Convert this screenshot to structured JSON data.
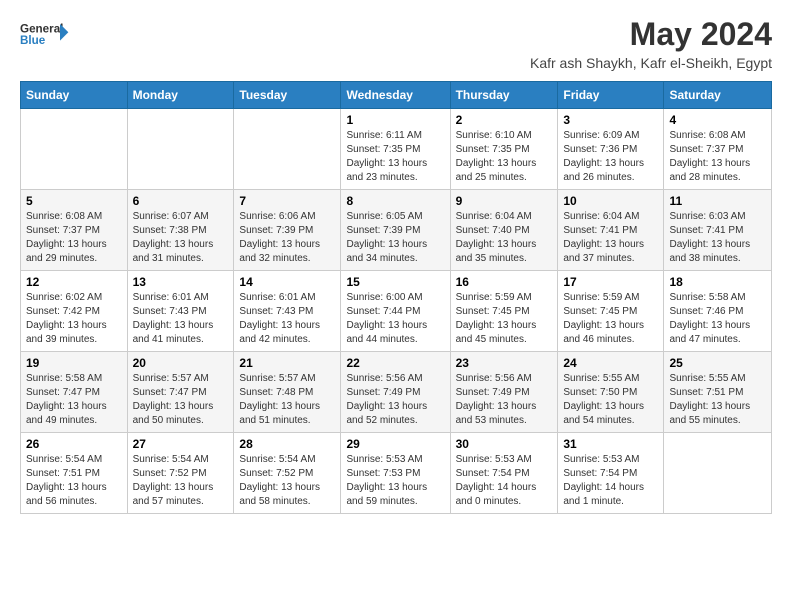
{
  "header": {
    "logo_general": "General",
    "logo_blue": "Blue",
    "title": "May 2024",
    "subtitle": "Kafr ash Shaykh, Kafr el-Sheikh, Egypt"
  },
  "columns": [
    "Sunday",
    "Monday",
    "Tuesday",
    "Wednesday",
    "Thursday",
    "Friday",
    "Saturday"
  ],
  "weeks": [
    [
      {
        "day": "",
        "info": ""
      },
      {
        "day": "",
        "info": ""
      },
      {
        "day": "",
        "info": ""
      },
      {
        "day": "1",
        "info": "Sunrise: 6:11 AM\nSunset: 7:35 PM\nDaylight: 13 hours\nand 23 minutes."
      },
      {
        "day": "2",
        "info": "Sunrise: 6:10 AM\nSunset: 7:35 PM\nDaylight: 13 hours\nand 25 minutes."
      },
      {
        "day": "3",
        "info": "Sunrise: 6:09 AM\nSunset: 7:36 PM\nDaylight: 13 hours\nand 26 minutes."
      },
      {
        "day": "4",
        "info": "Sunrise: 6:08 AM\nSunset: 7:37 PM\nDaylight: 13 hours\nand 28 minutes."
      }
    ],
    [
      {
        "day": "5",
        "info": "Sunrise: 6:08 AM\nSunset: 7:37 PM\nDaylight: 13 hours\nand 29 minutes."
      },
      {
        "day": "6",
        "info": "Sunrise: 6:07 AM\nSunset: 7:38 PM\nDaylight: 13 hours\nand 31 minutes."
      },
      {
        "day": "7",
        "info": "Sunrise: 6:06 AM\nSunset: 7:39 PM\nDaylight: 13 hours\nand 32 minutes."
      },
      {
        "day": "8",
        "info": "Sunrise: 6:05 AM\nSunset: 7:39 PM\nDaylight: 13 hours\nand 34 minutes."
      },
      {
        "day": "9",
        "info": "Sunrise: 6:04 AM\nSunset: 7:40 PM\nDaylight: 13 hours\nand 35 minutes."
      },
      {
        "day": "10",
        "info": "Sunrise: 6:04 AM\nSunset: 7:41 PM\nDaylight: 13 hours\nand 37 minutes."
      },
      {
        "day": "11",
        "info": "Sunrise: 6:03 AM\nSunset: 7:41 PM\nDaylight: 13 hours\nand 38 minutes."
      }
    ],
    [
      {
        "day": "12",
        "info": "Sunrise: 6:02 AM\nSunset: 7:42 PM\nDaylight: 13 hours\nand 39 minutes."
      },
      {
        "day": "13",
        "info": "Sunrise: 6:01 AM\nSunset: 7:43 PM\nDaylight: 13 hours\nand 41 minutes."
      },
      {
        "day": "14",
        "info": "Sunrise: 6:01 AM\nSunset: 7:43 PM\nDaylight: 13 hours\nand 42 minutes."
      },
      {
        "day": "15",
        "info": "Sunrise: 6:00 AM\nSunset: 7:44 PM\nDaylight: 13 hours\nand 44 minutes."
      },
      {
        "day": "16",
        "info": "Sunrise: 5:59 AM\nSunset: 7:45 PM\nDaylight: 13 hours\nand 45 minutes."
      },
      {
        "day": "17",
        "info": "Sunrise: 5:59 AM\nSunset: 7:45 PM\nDaylight: 13 hours\nand 46 minutes."
      },
      {
        "day": "18",
        "info": "Sunrise: 5:58 AM\nSunset: 7:46 PM\nDaylight: 13 hours\nand 47 minutes."
      }
    ],
    [
      {
        "day": "19",
        "info": "Sunrise: 5:58 AM\nSunset: 7:47 PM\nDaylight: 13 hours\nand 49 minutes."
      },
      {
        "day": "20",
        "info": "Sunrise: 5:57 AM\nSunset: 7:47 PM\nDaylight: 13 hours\nand 50 minutes."
      },
      {
        "day": "21",
        "info": "Sunrise: 5:57 AM\nSunset: 7:48 PM\nDaylight: 13 hours\nand 51 minutes."
      },
      {
        "day": "22",
        "info": "Sunrise: 5:56 AM\nSunset: 7:49 PM\nDaylight: 13 hours\nand 52 minutes."
      },
      {
        "day": "23",
        "info": "Sunrise: 5:56 AM\nSunset: 7:49 PM\nDaylight: 13 hours\nand 53 minutes."
      },
      {
        "day": "24",
        "info": "Sunrise: 5:55 AM\nSunset: 7:50 PM\nDaylight: 13 hours\nand 54 minutes."
      },
      {
        "day": "25",
        "info": "Sunrise: 5:55 AM\nSunset: 7:51 PM\nDaylight: 13 hours\nand 55 minutes."
      }
    ],
    [
      {
        "day": "26",
        "info": "Sunrise: 5:54 AM\nSunset: 7:51 PM\nDaylight: 13 hours\nand 56 minutes."
      },
      {
        "day": "27",
        "info": "Sunrise: 5:54 AM\nSunset: 7:52 PM\nDaylight: 13 hours\nand 57 minutes."
      },
      {
        "day": "28",
        "info": "Sunrise: 5:54 AM\nSunset: 7:52 PM\nDaylight: 13 hours\nand 58 minutes."
      },
      {
        "day": "29",
        "info": "Sunrise: 5:53 AM\nSunset: 7:53 PM\nDaylight: 13 hours\nand 59 minutes."
      },
      {
        "day": "30",
        "info": "Sunrise: 5:53 AM\nSunset: 7:54 PM\nDaylight: 14 hours\nand 0 minutes."
      },
      {
        "day": "31",
        "info": "Sunrise: 5:53 AM\nSunset: 7:54 PM\nDaylight: 14 hours\nand 1 minute."
      },
      {
        "day": "",
        "info": ""
      }
    ]
  ]
}
